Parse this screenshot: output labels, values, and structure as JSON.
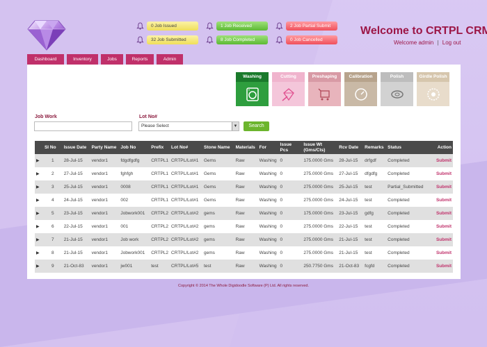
{
  "header": {
    "brand": "Welcome to CRTPL CRM",
    "welcome_prefix": "Welcome",
    "user": "admin",
    "separator": "|",
    "logout": "Log out"
  },
  "notifications": [
    {
      "text": "0 Job Issued",
      "color": "yellow"
    },
    {
      "text": "32 Job Submitted",
      "color": "yellow"
    },
    {
      "text": "1 Job Received",
      "color": "green"
    },
    {
      "text": "8 Job Completed",
      "color": "green"
    },
    {
      "text": "2 Job Partial Submit",
      "color": "red"
    },
    {
      "text": "0 Job Cancelled",
      "color": "red"
    }
  ],
  "nav": [
    "Dashboard",
    "Inventory",
    "Jobs",
    "Reports",
    "Admin"
  ],
  "stages": [
    {
      "label": "Washing",
      "bg": "#2e9e3e",
      "head": "#1a7a2b",
      "icon": "washing-machine-icon"
    },
    {
      "label": "Cutting",
      "bg": "#f4c6da",
      "head": "#f0b4cd",
      "icon": "diamond-cutting-icon"
    },
    {
      "label": "Preshaping",
      "bg": "#e8b4bc",
      "head": "#d89aa5",
      "icon": "cart-icon"
    },
    {
      "label": "Calibration",
      "bg": "#c9b9a6",
      "head": "#b7a38c",
      "icon": "gauge-icon"
    },
    {
      "label": "Polish",
      "bg": "#d2d2d2",
      "head": "#bdbdbd",
      "icon": "polish-wheel-icon"
    },
    {
      "label": "Girdle Polish",
      "bg": "#e8dccb",
      "head": "#d6c6ad",
      "icon": "gear-disc-icon"
    }
  ],
  "filters": {
    "job_work_label": "Job Work",
    "job_work_value": "",
    "lot_no_label": "Lot No#",
    "lot_no_value": "Please Select",
    "search_label": "Search"
  },
  "table": {
    "headers": [
      "",
      "Sl No",
      "Issue Date",
      "Party Name",
      "Job No",
      "Prefix",
      "Lot No#",
      "Stone Name",
      "Materials",
      "For",
      "Issue Pcs",
      "Issue Wt (Gms/Cts)",
      "Rcv Date",
      "Remarks",
      "Status",
      "Action"
    ],
    "rows": [
      [
        "1",
        "28-Jul-15",
        "vendor1",
        "fdgdfgdfg",
        "CRTPL1",
        "CRTPL/Lot#1",
        "Gems",
        "Raw",
        "Washing",
        "0",
        "175.0000 Gms",
        "28-Jul-15",
        "drfgdf",
        "Completed",
        "Submit"
      ],
      [
        "2",
        "27-Jul-15",
        "vendor1",
        "fghfgh",
        "CRTPL1",
        "CRTPL/Lot#1",
        "Gems",
        "Raw",
        "Washing",
        "0",
        "275.0000 Gms",
        "27-Jul-15",
        "dfgdfg",
        "Completed",
        "Submit"
      ],
      [
        "3",
        "25-Jul-15",
        "vendor1",
        "0008",
        "CRTPL1",
        "CRTPL/Lot#1",
        "Gems",
        "Raw",
        "Washing",
        "0",
        "275.0000 Gms",
        "25-Jul-15",
        "test",
        "Partial_Submitted",
        "Submit"
      ],
      [
        "4",
        "24-Jul-15",
        "vendor1",
        "002",
        "CRTPL1",
        "CRTPL/Lot#1",
        "Gems",
        "Raw",
        "Washing",
        "0",
        "275.0000 Gms",
        "24-Jul-15",
        "test",
        "Completed",
        "Submit"
      ],
      [
        "5",
        "23-Jul-15",
        "vendor1",
        "Jobwork001",
        "CRTPL2",
        "CRTPL/Lot#2",
        "gems",
        "Raw",
        "Washing",
        "0",
        "175.0000 Gms",
        "23-Jul-15",
        "gdfg",
        "Completed",
        "Submit"
      ],
      [
        "6",
        "22-Jul-15",
        "vendor1",
        "001",
        "CRTPL2",
        "CRTPL/Lot#2",
        "gems",
        "Raw",
        "Washing",
        "0",
        "275.0000 Gms",
        "22-Jul-15",
        "test",
        "Completed",
        "Submit"
      ],
      [
        "7",
        "21-Jul-15",
        "vendor1",
        "Job work",
        "CRTPL2",
        "CRTPL/Lot#2",
        "gems",
        "Raw",
        "Washing",
        "0",
        "275.0000 Gms",
        "21-Jul-15",
        "test",
        "Completed",
        "Submit"
      ],
      [
        "8",
        "21-Jul-15",
        "vendor1",
        "Jobwork001",
        "CRTPL2",
        "CRTPL/Lot#2",
        "gems",
        "Raw",
        "Washing",
        "0",
        "275.0000 Gms",
        "21-Jul-15",
        "test",
        "Completed",
        "Submit"
      ],
      [
        "9",
        "21-Oct-83",
        "vendor1",
        "jw001",
        "test",
        "CRTPL/Lot#5",
        "test",
        "Raw",
        "Washing",
        "0",
        "250.7750 Gms",
        "21-Oct-83",
        "fcgfd",
        "Completed",
        "Submit"
      ]
    ]
  },
  "footer": "Copyright © 2014 The Whole Digidoodle Software (P) Ltd. All rights reserved."
}
